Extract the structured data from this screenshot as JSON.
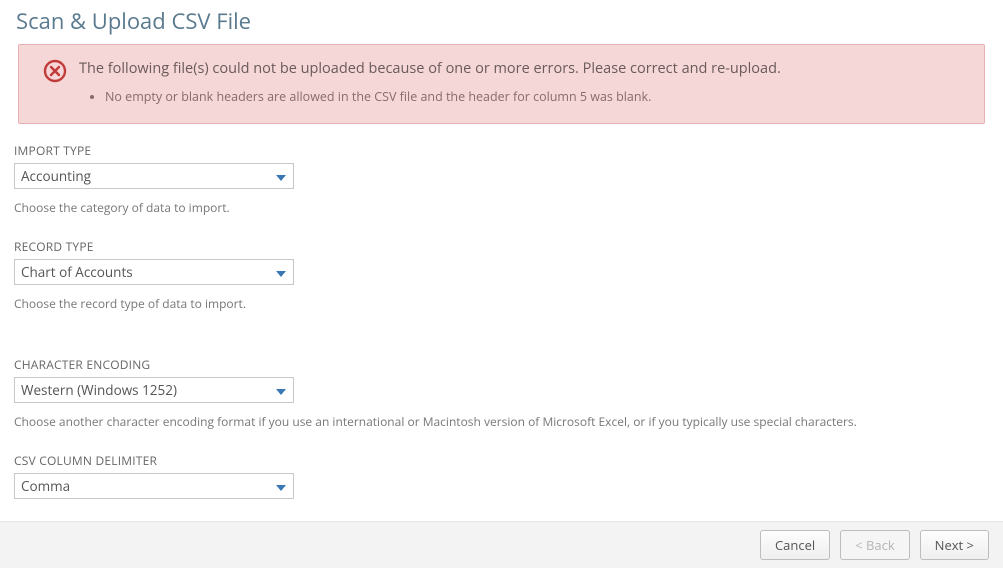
{
  "title": "Scan & Upload CSV File",
  "alert": {
    "message": "The following file(s) could not be uploaded because of one or more errors. Please correct and re-upload.",
    "details": "No empty or blank headers are allowed in the CSV file and the header for column 5 was blank."
  },
  "fields": {
    "import_type": {
      "label": "IMPORT TYPE",
      "value": "Accounting",
      "help": "Choose the category of data to import."
    },
    "record_type": {
      "label": "RECORD TYPE",
      "value": "Chart of Accounts",
      "help": "Choose the record type of data to import."
    },
    "encoding": {
      "label": "CHARACTER ENCODING",
      "value": "Western (Windows 1252)",
      "help": "Choose another character encoding format if you use an international or Macintosh version of Microsoft Excel, or if you typically use special characters."
    },
    "delimiter": {
      "label": "CSV COLUMN DELIMITER",
      "value": "Comma"
    }
  },
  "buttons": {
    "cancel": "Cancel",
    "back": "< Back",
    "next": "Next >"
  }
}
